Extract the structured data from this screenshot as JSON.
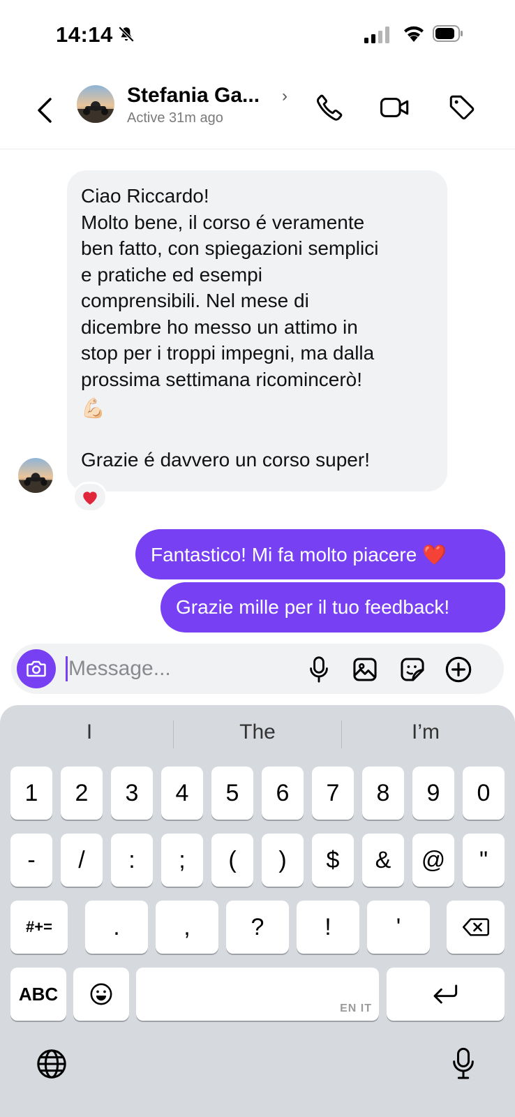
{
  "status_bar": {
    "time": "14:14"
  },
  "header": {
    "contact_name": "Stefania Ga...",
    "chevron": "›",
    "active_status": "Active 31m ago",
    "icons": [
      "back-icon",
      "phone-icon",
      "video-camera-icon",
      "tag-icon"
    ]
  },
  "messages": {
    "received": {
      "lines_1": [
        "Ciao Riccardo!",
        "Molto bene, il corso é veramente",
        "ben fatto, con spiegazioni semplici",
        "e pratiche ed esempi",
        "comprensibili. Nel mese di",
        "dicembre ho messo un attimo in",
        "stop per i troppi impegni, ma dalla",
        "prossima settimana ricomincerò!"
      ],
      "emoji": "💪🏻",
      "closing": "Grazie é davvero un corso super!",
      "reaction": "❤️"
    },
    "sent": [
      "Fantastico! Mi fa molto piacere ❤️",
      "Grazie mille per il tuo feedback!"
    ]
  },
  "composer": {
    "placeholder": "Message...",
    "icons": [
      "camera-icon",
      "microphone-icon",
      "image-icon",
      "sticker-icon",
      "plus-icon"
    ]
  },
  "keyboard": {
    "suggestions": [
      "I",
      "The",
      "I’m"
    ],
    "row1": [
      "1",
      "2",
      "3",
      "4",
      "5",
      "6",
      "7",
      "8",
      "9",
      "0"
    ],
    "row2": [
      "-",
      "/",
      ":",
      ";",
      "(",
      ")",
      "$",
      "&",
      "@",
      "\""
    ],
    "row3_left": "#+=",
    "row3_keys": [
      ".",
      ",",
      "?",
      "!",
      "'"
    ],
    "abc_label": "ABC",
    "space_tag": "EN IT",
    "colors": {
      "accent": "#7740f2",
      "keyboard_bg": "#d6d9de"
    }
  },
  "colors": {
    "accent": "#7740f2",
    "bubble_received": "#f1f2f4"
  }
}
